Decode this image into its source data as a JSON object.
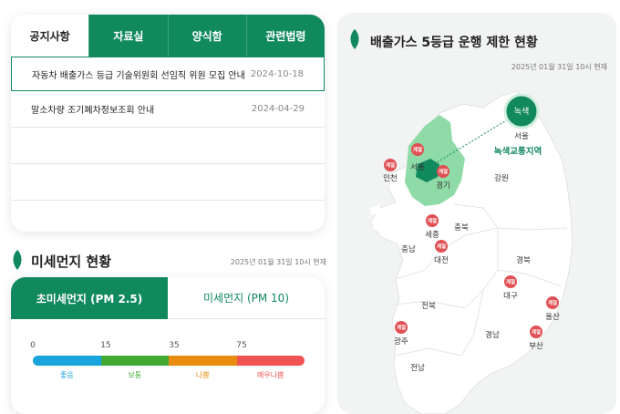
{
  "notice": {
    "tabs": [
      "공지사항",
      "자료실",
      "양식함",
      "관련법령"
    ],
    "rows": [
      {
        "title": "자동차 배출가스 등급 기술위원회 선임직 위원 모집 안내",
        "date": "2024-10-18"
      },
      {
        "title": "말소차량 조기폐차정보조회 안내",
        "date": "2024-04-29"
      }
    ]
  },
  "dust": {
    "title": "미세먼지 현황",
    "time": "2025년 01월 31일 10시 현재",
    "tabs": [
      "초미세먼지 (PM 2.5)",
      "미세먼지 (PM 10)"
    ],
    "scale_values": [
      "0",
      "15",
      "35",
      "75"
    ],
    "levels": [
      {
        "label": "좋음",
        "color": "#1aa4dd"
      },
      {
        "label": "보통",
        "color": "#42a935"
      },
      {
        "label": "나쁨",
        "color": "#e98b0e"
      },
      {
        "label": "매우나쁨",
        "color": "#ef5452"
      }
    ]
  },
  "map": {
    "title": "배출가스 5등급 운행 제한 현황",
    "time": "2025년 01월 31일 10시 현재",
    "green_badge": "녹색",
    "green_city": "서울",
    "green_zone": "녹색교통지역",
    "badge_text": "계절",
    "regions": {
      "seoul": "서울",
      "incheon": "인천",
      "gyeonggi": "경기",
      "gangwon": "강원",
      "chungbuk": "충북",
      "chungnam": "충남",
      "sejong": "세종",
      "daejeon": "대전",
      "gyeongbuk": "경북",
      "daegu": "대구",
      "ulsan": "울산",
      "jeonbuk": "전북",
      "gwangju": "광주",
      "gyeongnam": "경남",
      "busan": "부산",
      "jeonnam": "전남"
    }
  },
  "colors": {
    "accent": "#11895e",
    "badge": "#e05054",
    "map_land": "#ffffff",
    "map_highlight": "#8fdba8"
  }
}
